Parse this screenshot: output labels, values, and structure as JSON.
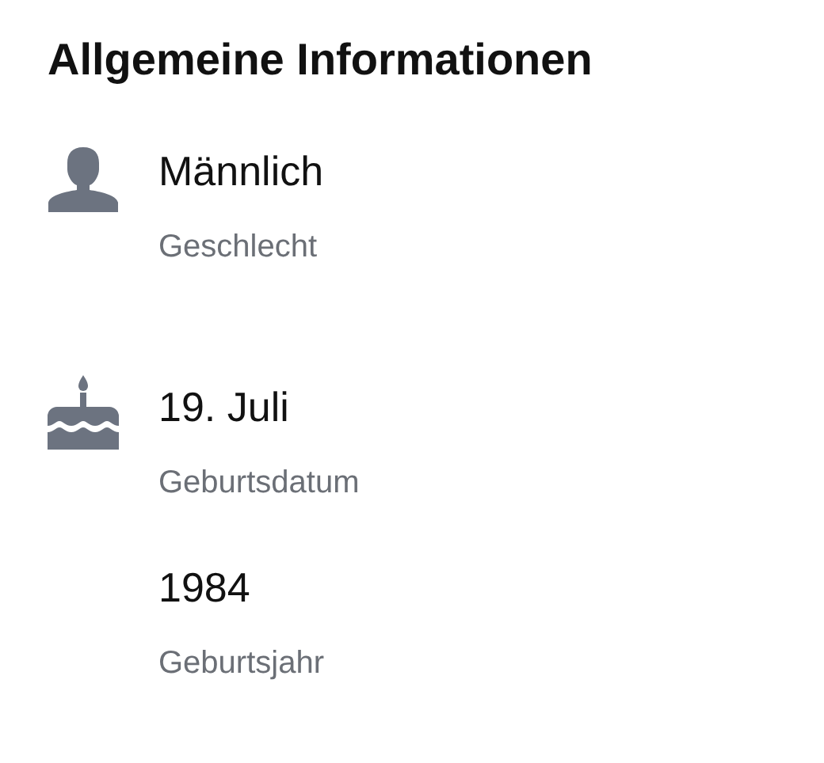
{
  "section": {
    "title": "Allgemeine Informationen"
  },
  "groups": [
    {
      "kind": "person",
      "entries": [
        {
          "value": "Männlich",
          "label": "Geschlecht"
        }
      ]
    },
    {
      "kind": "cake",
      "entries": [
        {
          "value": "19. Juli",
          "label": "Geburtsdatum"
        },
        {
          "value": "1984",
          "label": "Geburtsjahr"
        }
      ]
    }
  ]
}
